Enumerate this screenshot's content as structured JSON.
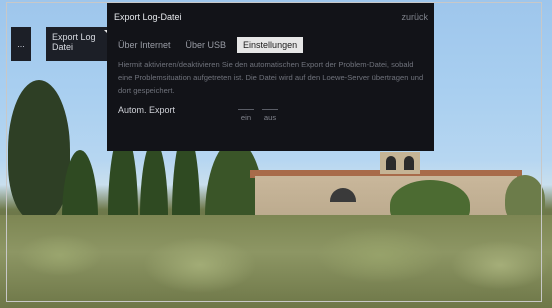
{
  "sidebar": {
    "ellipsis": "...",
    "current_item": "Export Log Datei"
  },
  "dialog": {
    "title": "Export Log-Datei",
    "back_label": "zurück",
    "tabs": [
      {
        "label": "Über Internet",
        "active": false
      },
      {
        "label": "Über USB",
        "active": false
      },
      {
        "label": "Einstellungen",
        "active": true
      }
    ],
    "description": "Hiermit aktivieren/deaktivieren Sie den automatischen Export der Problem-Datei, sobald eine Problemsituation aufgetreten ist. Die Datei wird auf den Loewe-Server übertragen und dort gespeichert.",
    "setting": {
      "label": "Autom. Export",
      "options": [
        "ein",
        "aus"
      ]
    }
  },
  "colors": {
    "dialog_bg": "#121318",
    "active_tab_bg": "#e6e6e6",
    "sky": "#a9cff0"
  }
}
